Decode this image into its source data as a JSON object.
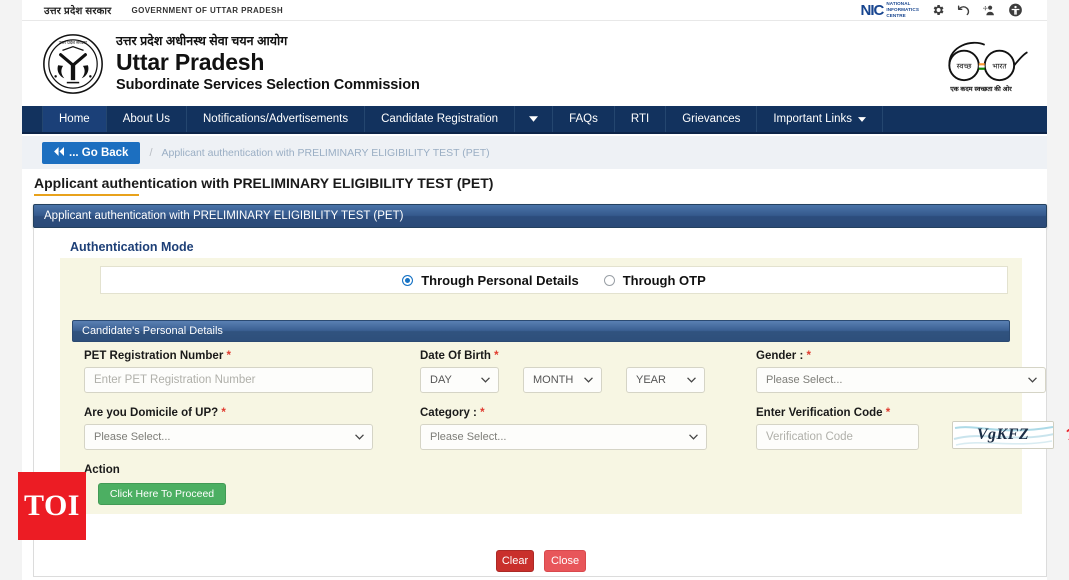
{
  "gov_strip": {
    "hindi": "उत्तर प्रदेश सरकार",
    "english": "GOVERNMENT OF UTTAR PRADESH",
    "nic": {
      "mark": "NIC",
      "line1": "National",
      "line2": "Informatics",
      "line3": "Centre"
    },
    "icons": [
      "gear-icon",
      "undo-icon",
      "add-user-icon",
      "accessibility-icon"
    ]
  },
  "brand": {
    "hindi": "उत्तर प्रदेश अधीनस्थ सेवा चयन आयोग",
    "line1": "Uttar Pradesh",
    "line2": "Subordinate Services Selection Commission",
    "emblem_alt": "uttar-pradesh-state-emblem",
    "swachh": {
      "left_word": "स्वच्छ",
      "right_word": "भारत",
      "caption": "एक कदम स्वच्छता की ओर"
    }
  },
  "nav": {
    "items": [
      {
        "label": "Home",
        "active": true,
        "caret": false
      },
      {
        "label": "About Us",
        "active": false,
        "caret": false
      },
      {
        "label": "Notifications/Advertisements",
        "active": false,
        "caret": false
      },
      {
        "label": "Candidate Registration",
        "active": false,
        "caret": false
      },
      {
        "label": "",
        "active": false,
        "caret": true
      },
      {
        "label": "FAQs",
        "active": false,
        "caret": false
      },
      {
        "label": "RTI",
        "active": false,
        "caret": false
      },
      {
        "label": "Grievances",
        "active": false,
        "caret": false
      },
      {
        "label": "Important Links",
        "active": false,
        "caret": true
      }
    ]
  },
  "breadcrumb": {
    "go_back": "... Go Back",
    "separator": "/",
    "current": "Applicant authentication with PRELIMINARY ELIGIBILITY TEST (PET)"
  },
  "page": {
    "title": "Applicant authentication with PRELIMINARY ELIGIBILITY TEST (PET)",
    "panel_title": "Applicant authentication with PRELIMINARY ELIGIBILITY TEST (PET)"
  },
  "auth_mode": {
    "section_label": "Authentication Mode",
    "options": [
      {
        "label": "Through Personal Details",
        "selected": true
      },
      {
        "label": "Through OTP",
        "selected": false
      }
    ]
  },
  "personal_details": {
    "header": "Candidate's Personal Details",
    "fields": {
      "pet_reg": {
        "label": "PET Registration Number",
        "required": "*",
        "placeholder": "Enter PET Registration Number",
        "value": ""
      },
      "dob": {
        "label": "Date Of Birth",
        "required": "*",
        "day": "DAY",
        "month": "MONTH",
        "year": "YEAR"
      },
      "gender": {
        "label": "Gender :",
        "required": "*",
        "value": "Please Select..."
      },
      "domicile": {
        "label": "Are you Domicile of UP?",
        "required": "*",
        "value": "Please Select..."
      },
      "category": {
        "label": "Category :",
        "required": "*",
        "value": "Please Select..."
      },
      "verification": {
        "label": "Enter Verification Code",
        "required": "*",
        "placeholder": "Verification Code",
        "value": "",
        "captcha_text": "VgKFZ"
      }
    },
    "action_label": "Action",
    "proceed_button": "Click Here To Proceed"
  },
  "footer_buttons": {
    "clear": "Clear",
    "close": "Close"
  },
  "watermark": {
    "text": "TOI"
  },
  "colors": {
    "nav_bg": "#12325e",
    "panel_header": "#35598c",
    "cream": "#f7f6e3",
    "primary_blue": "#1c6fc0",
    "green": "#4caf62",
    "red_clear": "#c9302c",
    "red_close": "#e8565a",
    "required_red": "#e03b2f",
    "title_underline": "#e8a21c",
    "toi_red": "#ec1c24"
  }
}
